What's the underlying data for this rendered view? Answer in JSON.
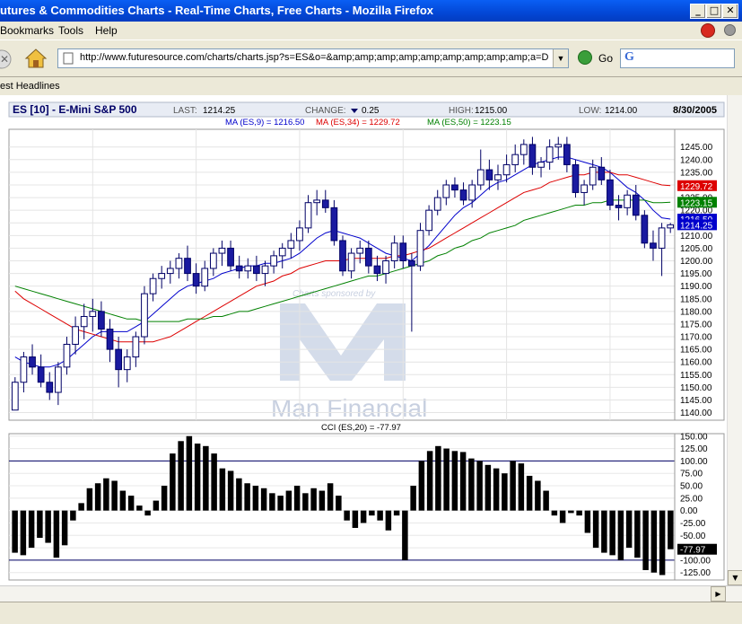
{
  "window": {
    "title": "utures & Commodities Charts - Real-Time Charts, Free Charts - Mozilla Firefox"
  },
  "menu": {
    "items": [
      "Bookmarks",
      "Tools",
      "Help"
    ]
  },
  "nav": {
    "url": "http://www.futuresource.com/charts/charts.jsp?s=ES&o=&amp;amp;amp;amp;amp;amp;amp;amp;amp;a=D",
    "go_label": "Go",
    "search_value": "G"
  },
  "bookmarks": {
    "items": [
      "est Headlines"
    ]
  },
  "chart_header": {
    "symbol": "ES [10] - E-Mini S&P 500",
    "last_label": "LAST:",
    "last": "1214.25",
    "change_label": "CHANGE:",
    "change": "0.25",
    "high_label": "HIGH:",
    "high": "1215.00",
    "low_label": "LOW:",
    "low": "1214.00",
    "date": "8/30/2005",
    "ma_labels": [
      {
        "text": "MA (ES,9) = 1216.50",
        "color": "#0000cc"
      },
      {
        "text": "MA (ES,34) = 1229.72",
        "color": "#dd0000"
      },
      {
        "text": "MA (ES,50) = 1223.15",
        "color": "#008000"
      }
    ]
  },
  "watermark": {
    "top": "Charts sponsored by",
    "brand": "Man Financial"
  },
  "chart_data": [
    {
      "type": "candlestick",
      "ylim": [
        1137,
        1252
      ],
      "y_ticks": [
        1140,
        1145,
        1150,
        1155,
        1160,
        1165,
        1170,
        1175,
        1180,
        1185,
        1190,
        1195,
        1200,
        1205,
        1210,
        1215,
        1220,
        1225,
        1230,
        1235,
        1240,
        1245
      ],
      "price_tags": [
        {
          "value": "1229.72",
          "color": "#dd0000"
        },
        {
          "value": "1223.15",
          "color": "#008000"
        },
        {
          "value": "1216.50",
          "color": "#0000cc"
        },
        {
          "value": "1214.25",
          "color": "#0000cc"
        }
      ],
      "candles": [
        [
          1141,
          1154,
          1141,
          1152
        ],
        [
          1152,
          1164,
          1148,
          1162
        ],
        [
          1162,
          1167,
          1155,
          1158
        ],
        [
          1158,
          1163,
          1150,
          1152
        ],
        [
          1152,
          1156,
          1145,
          1148
        ],
        [
          1148,
          1160,
          1143,
          1158
        ],
        [
          1158,
          1170,
          1155,
          1167
        ],
        [
          1167,
          1178,
          1163,
          1174
        ],
        [
          1174,
          1183,
          1169,
          1178
        ],
        [
          1178,
          1185,
          1172,
          1180
        ],
        [
          1180,
          1184,
          1170,
          1173
        ],
        [
          1173,
          1177,
          1160,
          1165
        ],
        [
          1165,
          1170,
          1150,
          1157
        ],
        [
          1157,
          1165,
          1152,
          1162
        ],
        [
          1162,
          1172,
          1158,
          1170
        ],
        [
          1170,
          1190,
          1167,
          1187
        ],
        [
          1187,
          1195,
          1184,
          1193
        ],
        [
          1193,
          1198,
          1189,
          1195
        ],
        [
          1195,
          1200,
          1191,
          1197
        ],
        [
          1197,
          1203,
          1193,
          1201
        ],
        [
          1201,
          1206,
          1192,
          1195
        ],
        [
          1195,
          1199,
          1187,
          1190
        ],
        [
          1190,
          1200,
          1188,
          1197
        ],
        [
          1197,
          1205,
          1194,
          1203
        ],
        [
          1203,
          1208,
          1198,
          1205
        ],
        [
          1205,
          1208,
          1196,
          1198
        ],
        [
          1198,
          1202,
          1193,
          1196
        ],
        [
          1196,
          1201,
          1193,
          1198
        ],
        [
          1198,
          1202,
          1192,
          1195
        ],
        [
          1195,
          1200,
          1190,
          1198
        ],
        [
          1198,
          1204,
          1195,
          1202
        ],
        [
          1202,
          1207,
          1197,
          1205
        ],
        [
          1205,
          1211,
          1201,
          1208
        ],
        [
          1208,
          1216,
          1204,
          1213
        ],
        [
          1213,
          1226,
          1211,
          1223
        ],
        [
          1223,
          1228,
          1218,
          1224
        ],
        [
          1224,
          1228,
          1219,
          1221
        ],
        [
          1221,
          1224,
          1206,
          1208
        ],
        [
          1208,
          1210,
          1194,
          1196
        ],
        [
          1196,
          1205,
          1193,
          1203
        ],
        [
          1203,
          1208,
          1199,
          1205
        ],
        [
          1205,
          1208,
          1195,
          1198
        ],
        [
          1198,
          1202,
          1192,
          1195
        ],
        [
          1195,
          1202,
          1191,
          1200
        ],
        [
          1200,
          1210,
          1197,
          1207
        ],
        [
          1207,
          1210,
          1197,
          1200
        ],
        [
          1200,
          1203,
          1172,
          1198
        ],
        [
          1198,
          1215,
          1196,
          1212
        ],
        [
          1212,
          1222,
          1210,
          1220
        ],
        [
          1220,
          1228,
          1218,
          1225
        ],
        [
          1225,
          1232,
          1222,
          1230
        ],
        [
          1230,
          1233,
          1225,
          1228
        ],
        [
          1228,
          1231,
          1222,
          1224
        ],
        [
          1224,
          1232,
          1221,
          1230
        ],
        [
          1230,
          1244,
          1228,
          1236
        ],
        [
          1236,
          1240,
          1228,
          1232
        ],
        [
          1232,
          1238,
          1228,
          1234
        ],
        [
          1234,
          1242,
          1231,
          1238
        ],
        [
          1238,
          1246,
          1235,
          1242
        ],
        [
          1242,
          1248,
          1238,
          1246
        ],
        [
          1246,
          1249,
          1234,
          1237
        ],
        [
          1237,
          1241,
          1233,
          1239
        ],
        [
          1239,
          1248,
          1236,
          1245
        ],
        [
          1245,
          1249,
          1240,
          1246
        ],
        [
          1246,
          1249,
          1235,
          1238
        ],
        [
          1238,
          1240,
          1225,
          1227
        ],
        [
          1227,
          1232,
          1222,
          1230
        ],
        [
          1230,
          1240,
          1228,
          1237
        ],
        [
          1237,
          1241,
          1230,
          1232
        ],
        [
          1232,
          1236,
          1220,
          1222
        ],
        [
          1222,
          1226,
          1216,
          1221
        ],
        [
          1221,
          1228,
          1218,
          1226
        ],
        [
          1226,
          1230,
          1216,
          1218
        ],
        [
          1218,
          1220,
          1205,
          1207
        ],
        [
          1207,
          1212,
          1200,
          1205
        ],
        [
          1205,
          1215,
          1194,
          1213
        ],
        [
          1213,
          1215,
          1211,
          1214.25
        ]
      ],
      "ma": {
        "ma9": [
          1162,
          1160,
          1159,
          1158,
          1158,
          1159,
          1161,
          1164,
          1167,
          1170,
          1172,
          1172,
          1172,
          1172,
          1174,
          1176,
          1179,
          1182,
          1185,
          1188,
          1190,
          1191,
          1192,
          1193,
          1195,
          1196,
          1197,
          1198,
          1198,
          1199,
          1199,
          1200,
          1201,
          1203,
          1206,
          1209,
          1211,
          1212,
          1211,
          1210,
          1209,
          1207,
          1205,
          1203,
          1202,
          1201,
          1200,
          1203,
          1206,
          1210,
          1214,
          1218,
          1221,
          1223,
          1226,
          1229,
          1231,
          1232,
          1234,
          1236,
          1238,
          1239,
          1240,
          1241,
          1241,
          1240,
          1239,
          1238,
          1237,
          1235,
          1232,
          1229,
          1227,
          1224,
          1220,
          1217,
          1216.5
        ],
        "ma34": [
          1188,
          1185,
          1183,
          1181,
          1179,
          1177,
          1175,
          1173,
          1172,
          1171,
          1170,
          1169,
          1168,
          1168,
          1168,
          1168,
          1168,
          1169,
          1170,
          1172,
          1174,
          1176,
          1178,
          1180,
          1182,
          1184,
          1186,
          1188,
          1190,
          1191,
          1192,
          1194,
          1195,
          1197,
          1198,
          1199,
          1200,
          1200,
          1200,
          1201,
          1201,
          1201,
          1201,
          1201,
          1202,
          1202,
          1203,
          1204,
          1205,
          1207,
          1209,
          1211,
          1213,
          1215,
          1217,
          1219,
          1221,
          1223,
          1225,
          1227,
          1228,
          1229,
          1231,
          1232,
          1233,
          1234,
          1234,
          1235,
          1235,
          1235,
          1234,
          1234,
          1233,
          1232,
          1231,
          1230,
          1229.72
        ],
        "ma50": [
          1190,
          1189,
          1188,
          1187,
          1186,
          1185,
          1184,
          1183,
          1182,
          1181,
          1180,
          1179,
          1178,
          1177,
          1177,
          1176,
          1176,
          1176,
          1176,
          1176,
          1177,
          1177,
          1177,
          1178,
          1178,
          1179,
          1180,
          1180,
          1181,
          1182,
          1183,
          1184,
          1185,
          1186,
          1187,
          1188,
          1189,
          1190,
          1191,
          1192,
          1193,
          1194,
          1194,
          1195,
          1196,
          1197,
          1198,
          1199,
          1200,
          1202,
          1203,
          1205,
          1206,
          1208,
          1209,
          1211,
          1212,
          1213,
          1214,
          1216,
          1217,
          1218,
          1219,
          1220,
          1221,
          1222,
          1222,
          1223,
          1223,
          1224,
          1224,
          1224,
          1224,
          1224,
          1223,
          1223,
          1223.15
        ]
      }
    },
    {
      "type": "bar",
      "title": "CCI (ES,20) = -77.97",
      "ylim": [
        -140,
        155
      ],
      "y_ticks": [
        150,
        125,
        100,
        75,
        50,
        25,
        0,
        -25,
        -50,
        -75,
        -100,
        -125
      ],
      "ref_lines": [
        100,
        -100
      ],
      "value_tag": "-77.97",
      "values": [
        -85,
        -90,
        -75,
        -55,
        -65,
        -95,
        -70,
        -20,
        15,
        45,
        55,
        65,
        60,
        40,
        30,
        10,
        -10,
        20,
        50,
        115,
        140,
        150,
        135,
        130,
        115,
        85,
        80,
        65,
        55,
        50,
        45,
        35,
        30,
        40,
        50,
        35,
        45,
        40,
        55,
        30,
        -20,
        -35,
        -25,
        -10,
        -20,
        -40,
        -10,
        -100,
        50,
        100,
        120,
        130,
        125,
        120,
        118,
        105,
        100,
        92,
        85,
        75,
        100,
        95,
        70,
        60,
        40,
        -10,
        -25,
        -5,
        -10,
        -45,
        -75,
        -85,
        -90,
        -100,
        -75,
        -95,
        -120,
        -125,
        -130,
        -77.97
      ]
    }
  ]
}
